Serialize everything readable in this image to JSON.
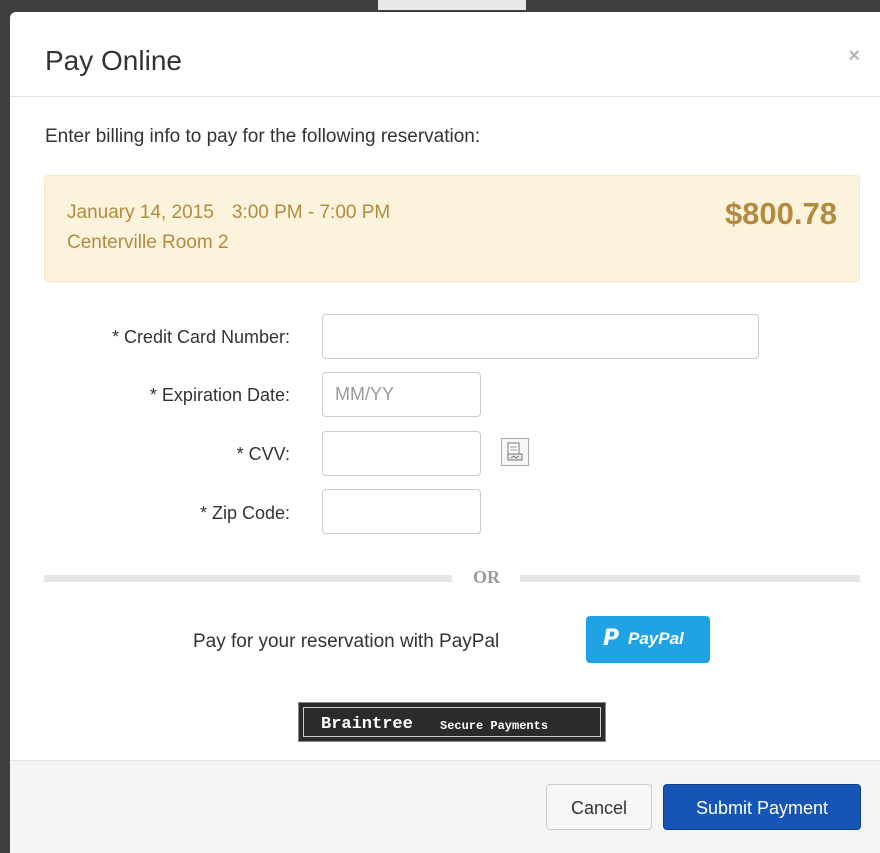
{
  "modal": {
    "title": "Pay Online",
    "close_label": "×",
    "intro": "Enter billing info to pay for the following reservation:"
  },
  "reservation": {
    "date": "January 14, 2015",
    "time": "3:00 PM - 7:00 PM",
    "room": "Centerville Room 2",
    "amount": "$800.78"
  },
  "form": {
    "card_number": {
      "label": "* Credit Card Number:",
      "value": "",
      "placeholder": ""
    },
    "expiration": {
      "label": "* Expiration Date:",
      "value": "",
      "placeholder": "MM/YY"
    },
    "cvv": {
      "label": "* CVV:",
      "value": "",
      "placeholder": ""
    },
    "zip": {
      "label": "* Zip Code:",
      "value": "",
      "placeholder": ""
    }
  },
  "divider": {
    "text": "OR"
  },
  "paypal": {
    "prompt": "Pay for your reservation with PayPal",
    "logo_glyph": "P",
    "button_label": "PayPal",
    "color": "#1fa3e5"
  },
  "braintree": {
    "name": "Braintree",
    "tagline": "Secure Payments"
  },
  "footer": {
    "cancel_label": "Cancel",
    "submit_label": "Submit Payment",
    "submit_color": "#1455b5"
  },
  "colors": {
    "reservation_bg": "#fcf3dd",
    "reservation_text": "#b48a3f"
  },
  "icons": {
    "cvv_help": "card-icon",
    "close": "close-icon"
  }
}
